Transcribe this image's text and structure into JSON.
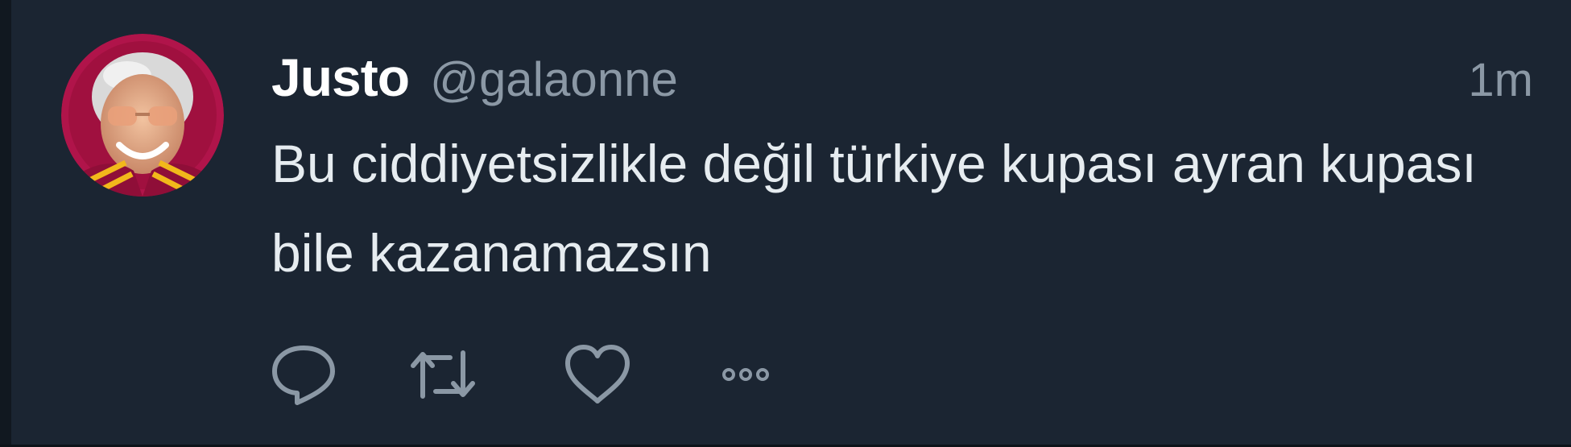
{
  "tweet": {
    "display_name": "Justo",
    "handle": "@galaonne",
    "timestamp": "1m",
    "text": "Bu ciddiyetsizlikle değil türkiye kupası ayran kupası bile kazanamazsın"
  },
  "avatar": {
    "icon": "user-avatar",
    "ring_color": "#b0144a"
  },
  "actions": [
    {
      "icon": "reply-icon"
    },
    {
      "icon": "retweet-icon"
    },
    {
      "icon": "like-icon"
    },
    {
      "icon": "more-icon"
    }
  ],
  "colors": {
    "background": "#1b2532",
    "name": "#ffffff",
    "secondary_text": "#8b98a5",
    "body_text": "#e6ecf0",
    "icon": "#8b98a5"
  }
}
